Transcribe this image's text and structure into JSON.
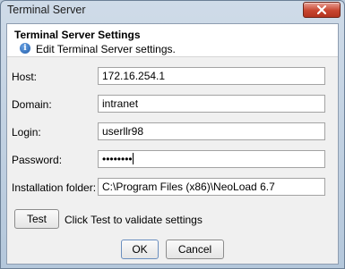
{
  "window": {
    "title": "Terminal Server"
  },
  "header": {
    "title": "Terminal Server Settings",
    "subtitle": "Edit Terminal Server settings."
  },
  "form": {
    "host": {
      "label": "Host:",
      "value": "172.16.254.1"
    },
    "domain": {
      "label": "Domain:",
      "value": "intranet"
    },
    "login": {
      "label": "Login:",
      "value": "userllr98"
    },
    "password": {
      "label": "Password:",
      "value": "••••••••"
    },
    "installation_folder": {
      "label": "Installation folder:",
      "value": "C:\\Program Files (x86)\\NeoLoad 6.7"
    }
  },
  "test": {
    "button_label": "Test",
    "hint": "Click Test to validate settings"
  },
  "footer": {
    "ok_label": "OK",
    "cancel_label": "Cancel"
  },
  "icons": {
    "close": "close-icon",
    "info": "info-icon"
  },
  "colors": {
    "close_button": "#c8452f",
    "info_icon": "#1f5aa6",
    "title_bar": "#c4d3e3"
  }
}
